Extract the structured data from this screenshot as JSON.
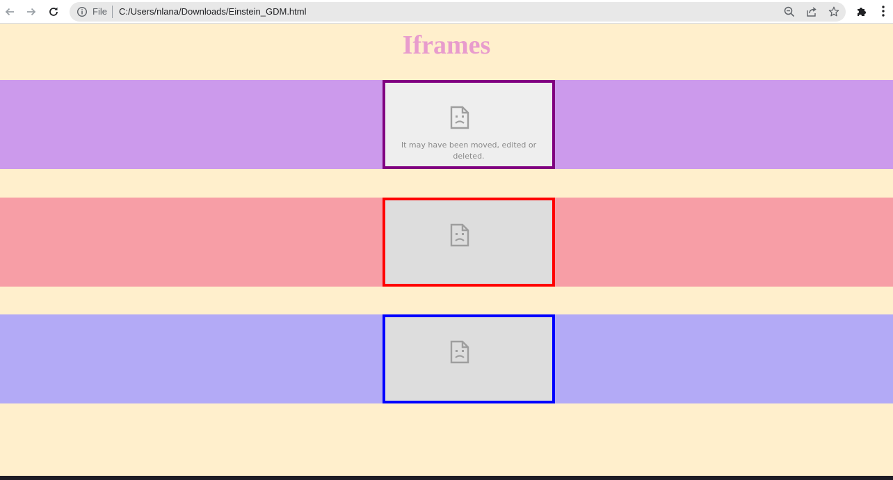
{
  "browser": {
    "scheme_label": "File",
    "url": "C:/Users/nlana/Downloads/Einstein_GDM.html",
    "icons": {
      "back": "back-arrow-icon",
      "forward": "forward-arrow-icon",
      "reload": "reload-icon",
      "info": "info-icon",
      "zoom": "zoom-out-icon",
      "share": "share-icon",
      "bookmark": "star-icon",
      "extensions": "puzzle-icon",
      "menu": "kebab-menu-icon"
    }
  },
  "page": {
    "title": "Iframes",
    "background": "#ffefcc",
    "title_color": "#e89ccd",
    "frames": [
      {
        "band_color": "#cc9aec",
        "frame_bg": "#eeeeee",
        "border_color": "#800080",
        "error_text": "It may have been moved, edited or deleted."
      },
      {
        "band_color": "#f79ea6",
        "frame_bg": "#dddddd",
        "border_color": "#ff0000",
        "error_text": ""
      },
      {
        "band_color": "#b3aaf6",
        "frame_bg": "#dddddd",
        "border_color": "#0000ff",
        "error_text": ""
      }
    ]
  }
}
